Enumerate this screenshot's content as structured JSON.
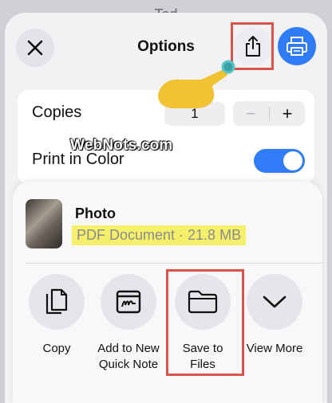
{
  "background": {
    "title_partial": "Tod"
  },
  "header": {
    "title": "Options"
  },
  "options": {
    "copies_label": "Copies",
    "copies_value": "1",
    "stepper_minus": "−",
    "stepper_plus": "+",
    "color_label": "Print in Color",
    "color_on": true
  },
  "watermark": "WebNots.com",
  "share": {
    "doc_name": "Photo",
    "doc_meta": "PDF Document · 21.8 MB",
    "actions": [
      {
        "label": "Copy",
        "icon": "copy-icon"
      },
      {
        "label": "Add to New Quick Note",
        "icon": "quick-note-icon"
      },
      {
        "label": "Save to Files",
        "icon": "folder-icon"
      },
      {
        "label": "View More",
        "icon": "chevron-down-icon"
      }
    ]
  },
  "colors": {
    "accent": "#2f7cf6",
    "highlight_box": "#d6544a",
    "highlighter": "#f4f06a"
  }
}
